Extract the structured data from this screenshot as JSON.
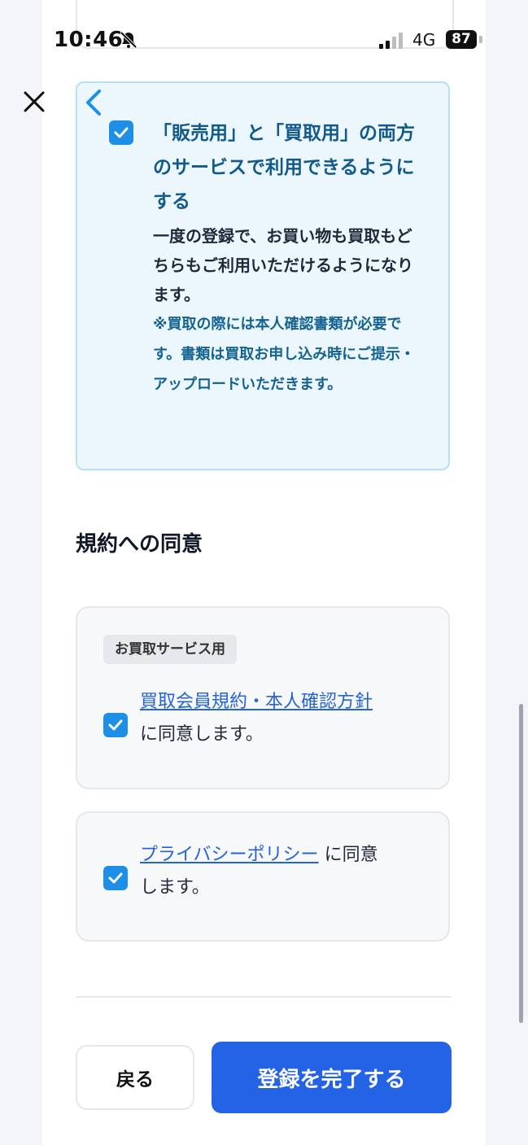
{
  "status": {
    "time": "10:46",
    "network": "4G",
    "battery": "87"
  },
  "info_box": {
    "title": "「販売用」と「買取用」の両方のサービスで利用できるようにする",
    "description": "一度の登録で、お買い物も買取もどちらもご利用いただけるようになります。",
    "note": "※買取の際には本人確認書類が必要です。書類は買取お申し込み時にご提示・アップロードいただきます。",
    "checked": true
  },
  "terms": {
    "section_title": "規約への同意",
    "buyback_card": {
      "tag": "お買取サービス用",
      "link_text": "買取会員規約・本人確認方針",
      "suffix": "に同意します。",
      "checked": true
    },
    "privacy_card": {
      "link_text": "プライバシーポリシー",
      "suffix_line1": "に同意",
      "suffix_line2": "します。",
      "checked": true
    }
  },
  "footer": {
    "back_label": "戻る",
    "submit_label": "登録を完了する"
  },
  "colors": {
    "primary": "#2563e6",
    "info_bg": "#ebf6fd",
    "checkbox": "#1e8fe6"
  }
}
